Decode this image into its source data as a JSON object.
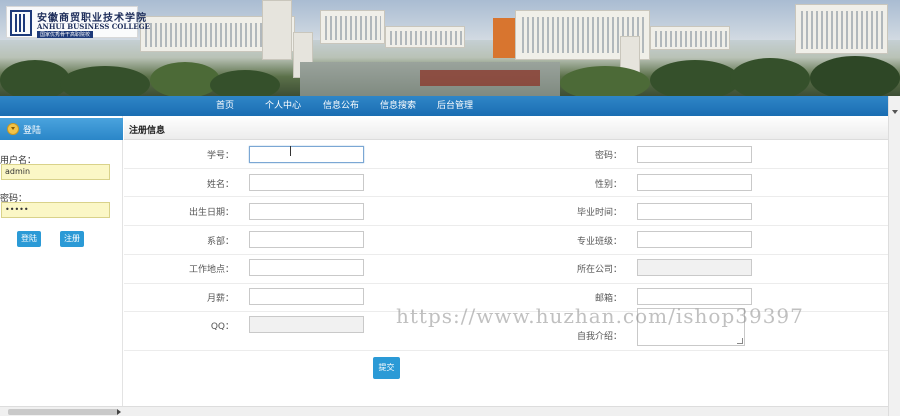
{
  "banner": {
    "logo_cn": "安徽商贸职业技术学院",
    "logo_en": "ANHUI BUSINESS COLLEGE",
    "logo_tag": "国家优秀骨干高职院校"
  },
  "nav": {
    "items": [
      "首页",
      "个人中心",
      "信息公布",
      "信息搜索",
      "后台管理"
    ]
  },
  "sidebar": {
    "title": "登陆",
    "username_label": "用户名：",
    "username_value": "admin",
    "password_label": "密码：",
    "password_value": "•••••",
    "login_button": "登陆",
    "register_button": "注册"
  },
  "form": {
    "title": "注册信息",
    "left_fields": [
      {
        "label": "学号："
      },
      {
        "label": "姓名："
      },
      {
        "label": "出生日期："
      },
      {
        "label": "系部："
      },
      {
        "label": "工作地点："
      },
      {
        "label": "月薪："
      },
      {
        "label": "QQ："
      }
    ],
    "right_fields": [
      {
        "label": "密码："
      },
      {
        "label": "性别："
      },
      {
        "label": "毕业时间："
      },
      {
        "label": "专业班级："
      },
      {
        "label": "所在公司："
      },
      {
        "label": "邮箱："
      },
      {
        "label": "自我介绍："
      }
    ],
    "submit_label": "提交"
  },
  "watermark": "https://www.huzhan.com/ishop39397",
  "colors": {
    "nav": "#1f78bd",
    "button": "#2b9ad6",
    "input_highlight": "#fbf7c6"
  }
}
